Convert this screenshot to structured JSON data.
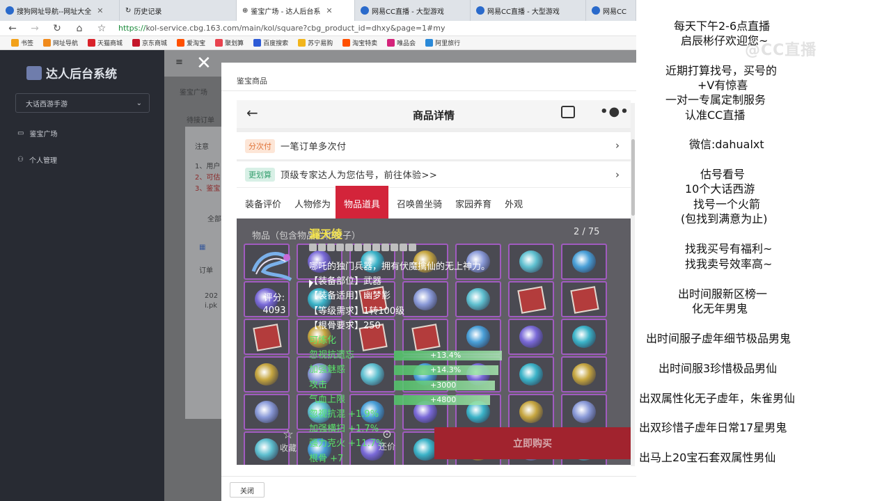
{
  "browser": {
    "tabs": [
      {
        "label": "搜狗网址导航--网址大全",
        "active": false
      },
      {
        "label": "历史记录",
        "active": false
      },
      {
        "label": "鉴宝广场 - 达人后台系",
        "active": true
      },
      {
        "label": "网易CC直播 - 大型游戏",
        "active": false
      },
      {
        "label": "网易CC直播 - 大型游戏",
        "active": false
      },
      {
        "label": "网易CC",
        "active": false
      }
    ],
    "url_scheme": "https://",
    "url_rest": "kol-service.cbg.163.com/main/kol/square?cbg_product_id=dhxy&page=1#my",
    "bookmarks": [
      {
        "label": "书签",
        "color": "#f2a11a"
      },
      {
        "label": "网址导航",
        "color": "#f08a1c"
      },
      {
        "label": "天猫商城",
        "color": "#d9222a"
      },
      {
        "label": "京东商城",
        "color": "#c4162a"
      },
      {
        "label": "爱淘宝",
        "color": "#ff5000"
      },
      {
        "label": "聚划算",
        "color": "#e8434f"
      },
      {
        "label": "百度搜索",
        "color": "#2e5bd6"
      },
      {
        "label": "苏宁易购",
        "color": "#f2b51b"
      },
      {
        "label": "淘宝特卖",
        "color": "#ff5000"
      },
      {
        "label": "唯品会",
        "color": "#d4237a"
      },
      {
        "label": "阿里旅行",
        "color": "#2a89d8"
      }
    ]
  },
  "sidebar": {
    "app_title": "达人后台系统",
    "game_select": "大话西游手游",
    "items": [
      {
        "label": "鉴宝广场",
        "icon": "monitor-icon"
      },
      {
        "label": "个人管理",
        "icon": "person-icon"
      }
    ]
  },
  "background": {
    "breadcrumb": "鉴宝广场",
    "tab": "待接订单",
    "note_label": "注意",
    "note_lines": [
      "1、用户",
      "2、可估",
      "3、鉴宝"
    ],
    "filter": "全部",
    "col": "订单",
    "row_date": "202",
    "row_id": "i.pk"
  },
  "modal": {
    "title": "鉴宝商品",
    "close_label": "关闭",
    "close_icon": "close-icon"
  },
  "phone": {
    "header_title": "商品详情",
    "rows": [
      {
        "badge": "分次付",
        "text": "一笔订单多次付",
        "badge_bg": "#fde6d7",
        "badge_color": "#e0743a"
      },
      {
        "badge": "更划算",
        "text": "顶级专家达人为您估号，前往体验>>",
        "badge_bg": "#d8f0e6",
        "badge_color": "#38a070"
      }
    ],
    "tabs": [
      "装备评价",
      "人物修为",
      "物品道具",
      "召唤兽坐骑",
      "家园养育",
      "外观"
    ],
    "active_tab": 2,
    "inventory_label": "物品（包含物品栏和柜子）",
    "counter": "2 / 75",
    "item_name": "漏天绫",
    "score_label": "评分:",
    "score_value": "4093",
    "tip_lines": [
      {
        "text": "哪吒的独门兵器，拥有伏魔擒仙的无上神力。",
        "color": "white"
      },
      {
        "text": "【装备部位】武器",
        "color": "white"
      },
      {
        "text": "【装备适用】幽梦影",
        "color": "white"
      },
      {
        "text": "【等级需求】1转100级",
        "color": "white"
      },
      {
        "text": "【根骨要求】250",
        "color": "white"
      },
      {
        "text": "可炼化",
        "color": "green"
      },
      {
        "text": "忽视抗遗忘",
        "color": "green"
      },
      {
        "text": "加强魅惑",
        "color": "green"
      },
      {
        "text": "攻击",
        "color": "green"
      },
      {
        "text": "气血上限",
        "color": "green"
      },
      {
        "text": "忽视抗混 +1.9%",
        "color": "green"
      },
      {
        "text": "加强横扫 +1.7%",
        "color": "green"
      },
      {
        "text": "强力克火 +11.7%",
        "color": "green"
      },
      {
        "text": "根骨 +7",
        "color": "green"
      }
    ],
    "bars": [
      {
        "value": "+13.4%",
        "fill": 0.62
      },
      {
        "value": "+14.3%",
        "fill": 0.6
      },
      {
        "value": "+3000",
        "fill": 0.58
      },
      {
        "value": "+4800",
        "fill": 0.55
      }
    ],
    "favorite_label": "收藏",
    "bargain_label": "还价",
    "buy_label": "立即购买"
  },
  "stream_panel": {
    "watermark": "@CC直播",
    "lines": [
      "每天下午2-6点直播",
      "启辰彬仔欢迎您~",
      "近期打算找号，买号的",
      "+V有惊喜",
      "一对一专属定制服务",
      "认准CC直播",
      "微信:dahualxt",
      "估号看号",
      "10个大话西游",
      "找号一个火箭",
      "(包找到满意为止)",
      "找我买号有福利~",
      "找我卖号效率高~",
      "出时间服新区榜一",
      "化无年男鬼",
      "出时间服子虚年细节极品男鬼",
      "出时间服3珍惜极品男仙",
      "出双属性化无子虚年，朱雀男仙",
      "出双珍惜子虚年日常17星男鬼",
      "出马上20宝石套双属性男仙"
    ]
  }
}
